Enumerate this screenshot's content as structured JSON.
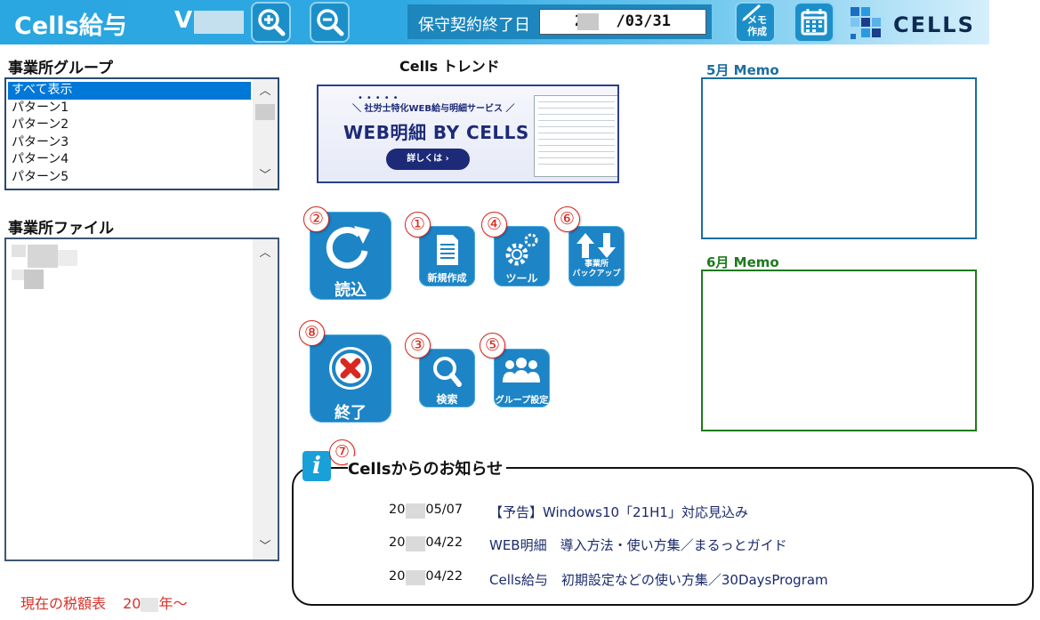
{
  "header": {
    "app_title": "Cells給与",
    "version_prefix": "V",
    "contract_label": "保守契約終了日",
    "contract_date_prefix": "20",
    "contract_date_suffix": "/03/31",
    "memo_button_label_line1": "メモ",
    "memo_button_label_line2": "作成",
    "logo_text": "CELLS"
  },
  "left": {
    "group_label": "事業所グループ",
    "groups": [
      "すべて表示",
      "パターン1",
      "パターン2",
      "パターン3",
      "パターン4",
      "パターン5"
    ],
    "selected_group_index": 0,
    "file_label": "事業所ファイル",
    "tax_label": "現在の税額表",
    "tax_year_prefix": "20",
    "tax_year_suffix": "年～"
  },
  "trend": {
    "title": "Cells トレンド",
    "banner_sub": "＼ 社労士特化WEB給与明細サービス ／",
    "banner_title": "WEB明細 BY CELLS",
    "banner_button": "詳しくは  ›"
  },
  "buttons": {
    "read": {
      "label": "読込",
      "badge": "②"
    },
    "new": {
      "label": "新規作成",
      "badge": "①"
    },
    "tool": {
      "label": "ツール",
      "badge": "④"
    },
    "backup": {
      "label_line1": "事業所",
      "label_line2": "バックアップ",
      "badge": "⑥"
    },
    "exit": {
      "label": "終了",
      "badge": "⑧"
    },
    "search": {
      "label": "検索",
      "badge": "③"
    },
    "group": {
      "label": "グループ設定",
      "badge": "⑤"
    }
  },
  "memos": {
    "may_title": "5月 Memo",
    "june_title": "6月 Memo",
    "may_color": "#1b6e9e",
    "june_color": "#1d7a1d"
  },
  "news": {
    "badge": "⑦",
    "title": "Cellsからのお知らせ",
    "items": [
      {
        "date_prefix": "20",
        "date_suffix": "/05/07",
        "text": "【予告】Windows10「21H1」対応見込み"
      },
      {
        "date_prefix": "20",
        "date_suffix": "/04/22",
        "text": "WEB明細　導入方法・使い方集／まるっとガイド"
      },
      {
        "date_prefix": "20",
        "date_suffix": "/04/22",
        "text": "Cells給与　初期設定などの使い方集／30DaysProgram"
      }
    ]
  },
  "colors": {
    "header_blue": "#2aa6e0",
    "button_blue": "#1d84c6",
    "badge_red": "#d8281f",
    "tax_red": "#d7322a"
  }
}
